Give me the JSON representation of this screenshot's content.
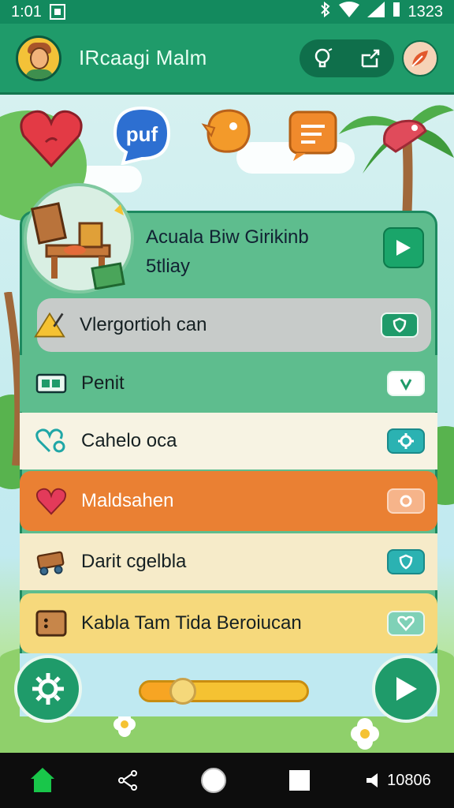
{
  "status_bar": {
    "time": "1:01",
    "right_text": "1323"
  },
  "app_bar": {
    "title": "IRcaagi Malm"
  },
  "hero": {
    "title_line1": "Acuala Biw Girikinb",
    "title_line2": "5tliay"
  },
  "menu": {
    "items": [
      {
        "label": "Vlergortioh can"
      },
      {
        "label": "Penit"
      },
      {
        "label": "Cahelo oca"
      },
      {
        "label": "Maldsahen"
      },
      {
        "label": "Darit cgelbla"
      },
      {
        "label": "Kabla Tam Tida Beroiucan"
      }
    ]
  },
  "slider": {
    "value_fraction": 0.25
  },
  "nav_bar": {
    "right_text": "10806"
  },
  "colors": {
    "primary": "#1f9b6a",
    "accent_orange": "#ea8033",
    "accent_yellow": "#f6d97c",
    "nav_green": "#19c64a"
  }
}
